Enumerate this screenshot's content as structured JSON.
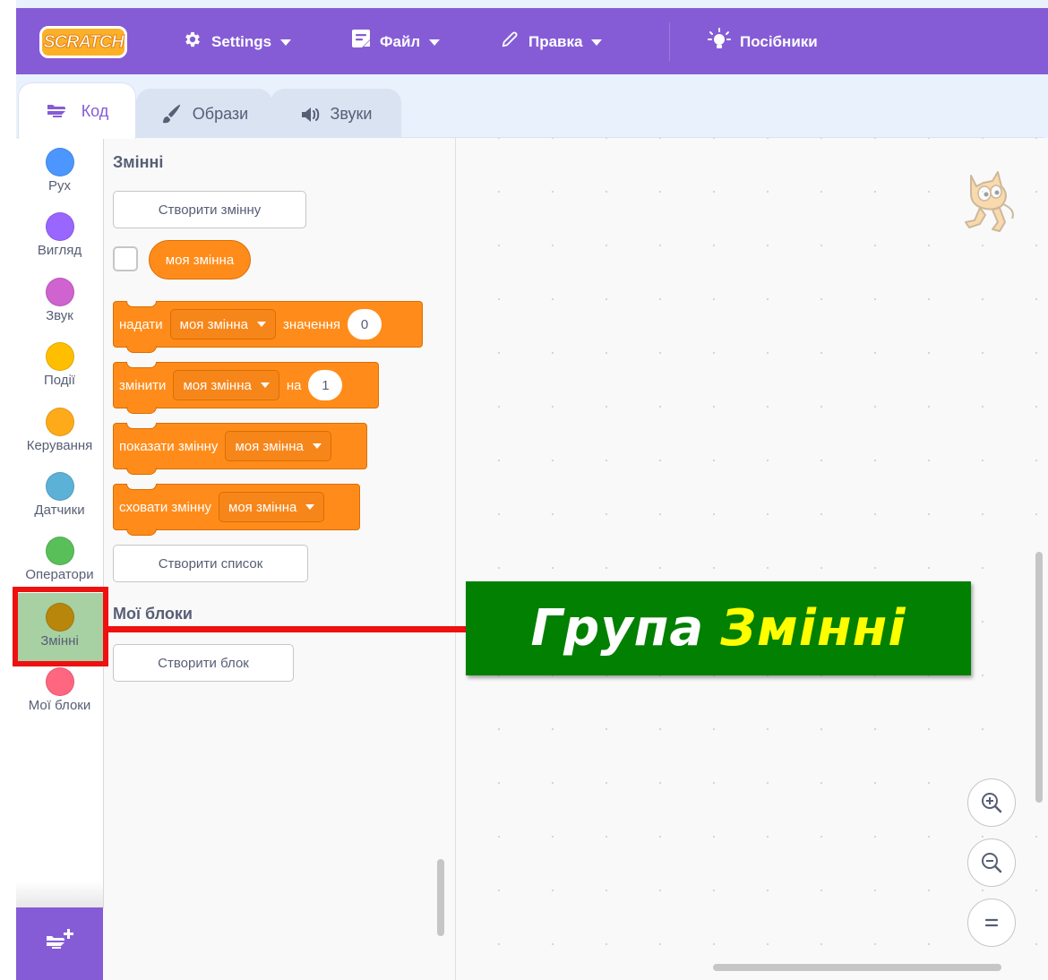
{
  "menubar": {
    "logo": "SCRATCH",
    "settings": "Settings",
    "file": "Файл",
    "edit": "Правка",
    "tutorials": "Посібники"
  },
  "tabs": [
    {
      "label": "Код",
      "active": true
    },
    {
      "label": "Образи",
      "active": false
    },
    {
      "label": "Звуки",
      "active": false
    }
  ],
  "categories": [
    {
      "label": "Рух",
      "color": "#4c97ff"
    },
    {
      "label": "Вигляд",
      "color": "#9966ff"
    },
    {
      "label": "Звук",
      "color": "#cf63cf"
    },
    {
      "label": "Події",
      "color": "#ffbf00"
    },
    {
      "label": "Керування",
      "color": "#ffab19"
    },
    {
      "label": "Датчики",
      "color": "#5cb1d6"
    },
    {
      "label": "Оператори",
      "color": "#59c059"
    },
    {
      "label": "Змінні",
      "color": "#b8860b",
      "selected": true
    },
    {
      "label": "Мої блоки",
      "color": "#ff6680"
    }
  ],
  "palette": {
    "variables_heading": "Змінні",
    "make_variable": "Створити змінну",
    "variable_reporter": "моя змінна",
    "blocks": {
      "set": {
        "text": "надати",
        "dropdown": "моя змінна",
        "text2": "значення",
        "value": "0"
      },
      "change": {
        "text": "змінити",
        "dropdown": "моя змінна",
        "text2": "на",
        "value": "1"
      },
      "show": {
        "text": "показати змінну",
        "dropdown": "моя змінна"
      },
      "hide": {
        "text": "сховати змінну",
        "dropdown": "моя змінна"
      }
    },
    "make_list": "Створити список",
    "myblocks_heading": "Мої блоки",
    "make_block": "Створити блок"
  },
  "annotation": {
    "prefix": "Група",
    "highlight": "Змінні"
  },
  "colors": {
    "menubar": "#855cd6",
    "block_orange": "#ff8c1a",
    "annotation_red": "#ee1111",
    "callout_green": "#018001",
    "callout_yellow": "#ffff00"
  }
}
